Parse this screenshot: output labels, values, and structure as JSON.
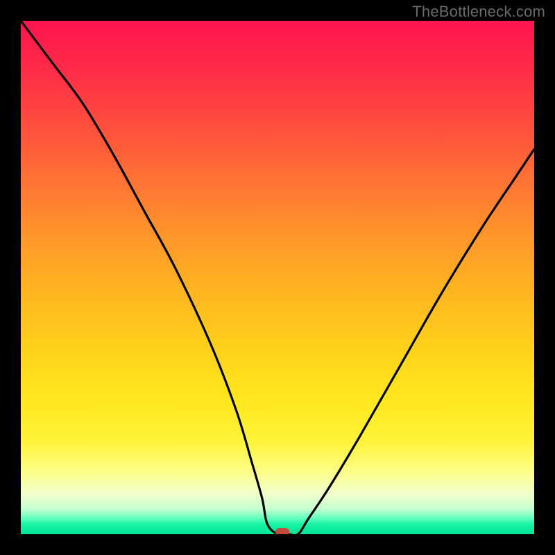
{
  "watermark": "TheBottleneck.com",
  "chart_data": {
    "type": "line",
    "title": "",
    "xlabel": "",
    "ylabel": "",
    "xlim": [
      0,
      100
    ],
    "ylim": [
      0,
      100
    ],
    "grid": false,
    "legend": false,
    "series": [
      {
        "name": "bottleneck-curve",
        "x": [
          0,
          6,
          12,
          18,
          24,
          30,
          37,
          42,
          45,
          47,
          48,
          50,
          52,
          54,
          56,
          60,
          66,
          74,
          82,
          90,
          96,
          100
        ],
        "values": [
          100,
          92,
          84,
          74,
          63,
          52,
          37,
          24,
          14,
          7,
          2,
          0,
          0,
          0,
          3,
          9,
          19,
          33,
          47,
          60,
          69,
          75
        ]
      }
    ],
    "marker": {
      "x": 51,
      "y": 0,
      "color": "#c44a3e"
    },
    "background_gradient": {
      "stops": [
        {
          "pos": 0.0,
          "color": "#ff134f"
        },
        {
          "pos": 0.24,
          "color": "#ff5a3a"
        },
        {
          "pos": 0.52,
          "color": "#ffb321"
        },
        {
          "pos": 0.82,
          "color": "#fff43a"
        },
        {
          "pos": 0.95,
          "color": "#c8ffd0"
        },
        {
          "pos": 1.0,
          "color": "#00e696"
        }
      ]
    }
  }
}
